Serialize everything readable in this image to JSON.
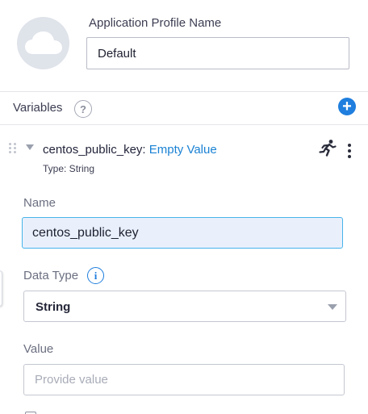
{
  "profile": {
    "label": "Application Profile Name",
    "name_value": "Default",
    "avatar_icon": "cloud-icon"
  },
  "variables": {
    "label": "Variables",
    "help_glyph": "?",
    "add_glyph": "+",
    "item": {
      "name": "centos_public_key:",
      "value_text": "Empty Value",
      "type_text": "Type: String",
      "runtime_icon": "running-man-icon",
      "menu_icon": "more-vertical-icon"
    }
  },
  "form": {
    "name_label": "Name",
    "name_value": "centos_public_key",
    "data_type_label": "Data Type",
    "info_glyph": "i",
    "data_type_value": "String",
    "value_label": "Value",
    "value_placeholder": "Provide value"
  },
  "colors": {
    "accent_blue": "#1f7ede",
    "link_blue": "#1a82d4",
    "focus_border": "#47b3ea",
    "focus_background": "#e9f0fc"
  }
}
